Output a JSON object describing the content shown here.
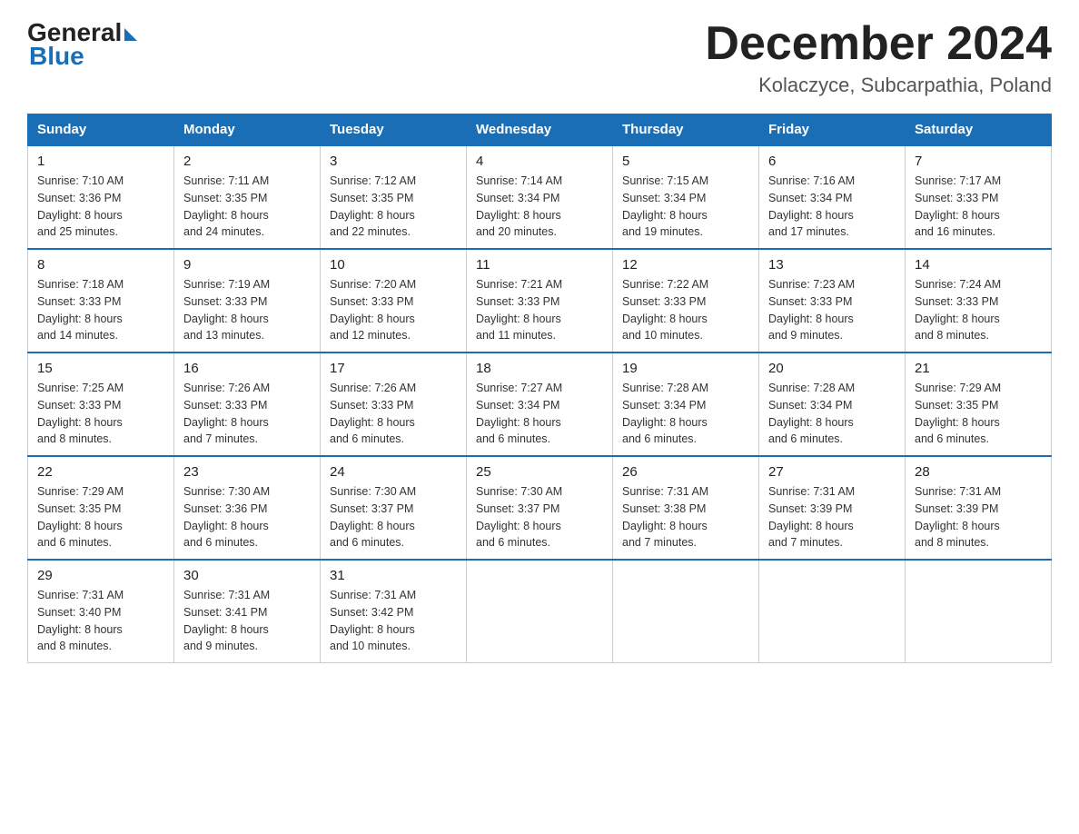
{
  "header": {
    "logo_general": "General",
    "logo_blue": "Blue",
    "month_title": "December 2024",
    "location": "Kolaczyce, Subcarpathia, Poland"
  },
  "columns": [
    "Sunday",
    "Monday",
    "Tuesday",
    "Wednesday",
    "Thursday",
    "Friday",
    "Saturday"
  ],
  "weeks": [
    [
      {
        "day": "1",
        "sunrise": "7:10 AM",
        "sunset": "3:36 PM",
        "daylight": "8 hours and 25 minutes."
      },
      {
        "day": "2",
        "sunrise": "7:11 AM",
        "sunset": "3:35 PM",
        "daylight": "8 hours and 24 minutes."
      },
      {
        "day": "3",
        "sunrise": "7:12 AM",
        "sunset": "3:35 PM",
        "daylight": "8 hours and 22 minutes."
      },
      {
        "day": "4",
        "sunrise": "7:14 AM",
        "sunset": "3:34 PM",
        "daylight": "8 hours and 20 minutes."
      },
      {
        "day": "5",
        "sunrise": "7:15 AM",
        "sunset": "3:34 PM",
        "daylight": "8 hours and 19 minutes."
      },
      {
        "day": "6",
        "sunrise": "7:16 AM",
        "sunset": "3:34 PM",
        "daylight": "8 hours and 17 minutes."
      },
      {
        "day": "7",
        "sunrise": "7:17 AM",
        "sunset": "3:33 PM",
        "daylight": "8 hours and 16 minutes."
      }
    ],
    [
      {
        "day": "8",
        "sunrise": "7:18 AM",
        "sunset": "3:33 PM",
        "daylight": "8 hours and 14 minutes."
      },
      {
        "day": "9",
        "sunrise": "7:19 AM",
        "sunset": "3:33 PM",
        "daylight": "8 hours and 13 minutes."
      },
      {
        "day": "10",
        "sunrise": "7:20 AM",
        "sunset": "3:33 PM",
        "daylight": "8 hours and 12 minutes."
      },
      {
        "day": "11",
        "sunrise": "7:21 AM",
        "sunset": "3:33 PM",
        "daylight": "8 hours and 11 minutes."
      },
      {
        "day": "12",
        "sunrise": "7:22 AM",
        "sunset": "3:33 PM",
        "daylight": "8 hours and 10 minutes."
      },
      {
        "day": "13",
        "sunrise": "7:23 AM",
        "sunset": "3:33 PM",
        "daylight": "8 hours and 9 minutes."
      },
      {
        "day": "14",
        "sunrise": "7:24 AM",
        "sunset": "3:33 PM",
        "daylight": "8 hours and 8 minutes."
      }
    ],
    [
      {
        "day": "15",
        "sunrise": "7:25 AM",
        "sunset": "3:33 PM",
        "daylight": "8 hours and 8 minutes."
      },
      {
        "day": "16",
        "sunrise": "7:26 AM",
        "sunset": "3:33 PM",
        "daylight": "8 hours and 7 minutes."
      },
      {
        "day": "17",
        "sunrise": "7:26 AM",
        "sunset": "3:33 PM",
        "daylight": "8 hours and 6 minutes."
      },
      {
        "day": "18",
        "sunrise": "7:27 AM",
        "sunset": "3:34 PM",
        "daylight": "8 hours and 6 minutes."
      },
      {
        "day": "19",
        "sunrise": "7:28 AM",
        "sunset": "3:34 PM",
        "daylight": "8 hours and 6 minutes."
      },
      {
        "day": "20",
        "sunrise": "7:28 AM",
        "sunset": "3:34 PM",
        "daylight": "8 hours and 6 minutes."
      },
      {
        "day": "21",
        "sunrise": "7:29 AM",
        "sunset": "3:35 PM",
        "daylight": "8 hours and 6 minutes."
      }
    ],
    [
      {
        "day": "22",
        "sunrise": "7:29 AM",
        "sunset": "3:35 PM",
        "daylight": "8 hours and 6 minutes."
      },
      {
        "day": "23",
        "sunrise": "7:30 AM",
        "sunset": "3:36 PM",
        "daylight": "8 hours and 6 minutes."
      },
      {
        "day": "24",
        "sunrise": "7:30 AM",
        "sunset": "3:37 PM",
        "daylight": "8 hours and 6 minutes."
      },
      {
        "day": "25",
        "sunrise": "7:30 AM",
        "sunset": "3:37 PM",
        "daylight": "8 hours and 6 minutes."
      },
      {
        "day": "26",
        "sunrise": "7:31 AM",
        "sunset": "3:38 PM",
        "daylight": "8 hours and 7 minutes."
      },
      {
        "day": "27",
        "sunrise": "7:31 AM",
        "sunset": "3:39 PM",
        "daylight": "8 hours and 7 minutes."
      },
      {
        "day": "28",
        "sunrise": "7:31 AM",
        "sunset": "3:39 PM",
        "daylight": "8 hours and 8 minutes."
      }
    ],
    [
      {
        "day": "29",
        "sunrise": "7:31 AM",
        "sunset": "3:40 PM",
        "daylight": "8 hours and 8 minutes."
      },
      {
        "day": "30",
        "sunrise": "7:31 AM",
        "sunset": "3:41 PM",
        "daylight": "8 hours and 9 minutes."
      },
      {
        "day": "31",
        "sunrise": "7:31 AM",
        "sunset": "3:42 PM",
        "daylight": "8 hours and 10 minutes."
      },
      null,
      null,
      null,
      null
    ]
  ],
  "labels": {
    "sunrise": "Sunrise:",
    "sunset": "Sunset:",
    "daylight": "Daylight:"
  }
}
